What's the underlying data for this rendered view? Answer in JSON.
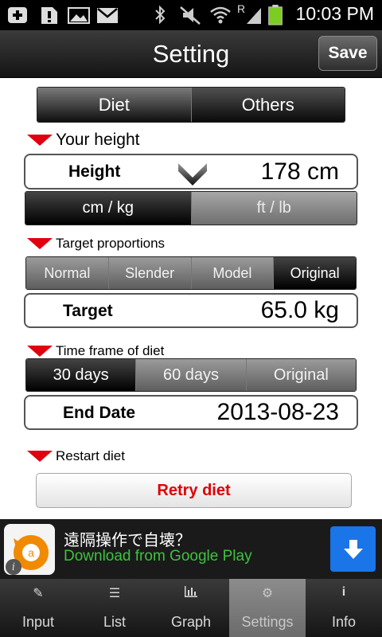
{
  "status_bar": {
    "time": "10:03 PM",
    "icons": [
      "add-icon",
      "sd-alert-icon",
      "gallery-icon",
      "mail-icon",
      "bluetooth-icon",
      "mute-icon",
      "wifi-icon",
      "roaming-signal-icon",
      "battery-icon"
    ],
    "roaming_label": "R"
  },
  "header": {
    "title": "Setting",
    "save_label": "Save"
  },
  "top_tabs": {
    "items": [
      "Diet",
      "Others"
    ],
    "selected": "Diet"
  },
  "height_section": {
    "label": "Your height",
    "field_label": "Height",
    "value": "178 cm",
    "units": [
      "cm / kg",
      "ft / lb"
    ],
    "selected_unit": "cm / kg"
  },
  "target_section": {
    "label": "Target proportions",
    "options": [
      "Normal",
      "Slender",
      "Model",
      "Original"
    ],
    "selected": "Original",
    "field_label": "Target",
    "value": "65.0 kg"
  },
  "time_section": {
    "label": "Time frame of diet",
    "options": [
      "30 days",
      "60 days",
      "Original"
    ],
    "selected": "30 days",
    "field_label": "End Date",
    "value": "2013-08-23"
  },
  "restart_section": {
    "label": "Restart diet",
    "button_label": "Retry diet",
    "button_color": "#e00000"
  },
  "ad": {
    "title": "遠隔操作で自壊？",
    "subtitle": "Download from Google Play",
    "info_label": "i",
    "subtitle_color": "#3fc23f",
    "button_color": "#1a75e8"
  },
  "bottom_nav": {
    "items": [
      {
        "label": "Input",
        "icon": "pencil-icon"
      },
      {
        "label": "List",
        "icon": "list-icon"
      },
      {
        "label": "Graph",
        "icon": "graph-icon"
      },
      {
        "label": "Settings",
        "icon": "gear-icon"
      },
      {
        "label": "Info",
        "icon": "info-icon"
      }
    ],
    "active": "Settings"
  },
  "colors": {
    "accent_red": "#e0000f"
  }
}
